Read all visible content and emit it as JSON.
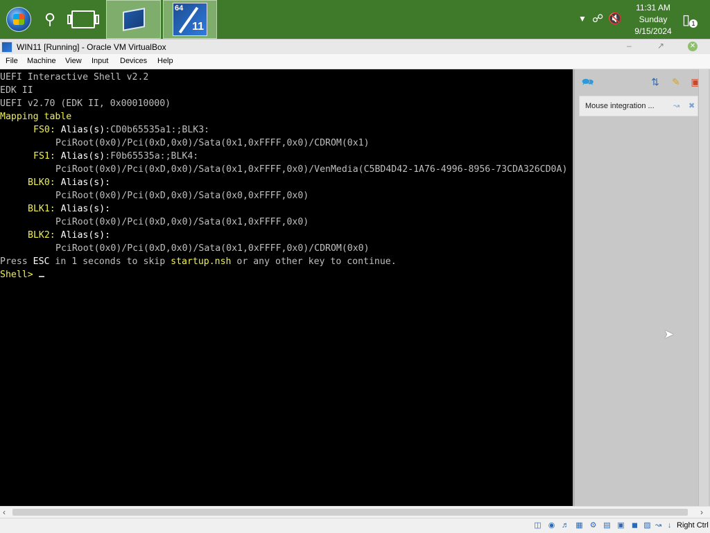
{
  "taskbar": {
    "icons": [
      "windows-start-orb",
      "search-icon",
      "task-view-icon",
      "virtualbox-app-icon",
      "windows-11-vm-icon"
    ],
    "vm_badge_bits": "64",
    "vm_badge_version": "11",
    "tray": {
      "time": "11:31 AM",
      "day": "Sunday",
      "date": "9/15/2024",
      "notification_count": "1"
    }
  },
  "window": {
    "title": "WIN11 [Running] - Oracle VM VirtualBox"
  },
  "menu": {
    "items": [
      "File",
      "Machine",
      "View",
      "Input",
      "Devices",
      "Help"
    ]
  },
  "console": {
    "lines": [
      "UEFI Interactive Shell v2.2",
      "EDK II",
      "UEFI v2.70 (EDK II, 0x00010000)",
      "Mapping table",
      "FS0:",
      "Alias(s)",
      ":CD0b65535a1:;BLK3:",
      "PciRoot(0x0)/Pci(0xD,0x0)/Sata(0x1,0xFFFF,0x0)/CDROM(0x1)",
      "FS1:",
      "Alias(s)",
      ":F0b65535a:;BLK4:",
      "PciRoot(0x0)/Pci(0xD,0x0)/Sata(0x1,0xFFFF,0x0)/VenMedia(C5BD4D42-1A76-4996-8956-73CDA326CD0A)",
      "BLK0:",
      "Alias(s):",
      "PciRoot(0x0)/Pci(0xD,0x0)/Sata(0x0,0xFFFF,0x0)",
      "BLK1:",
      "Alias(s):",
      "PciRoot(0x0)/Pci(0xD,0x0)/Sata(0x1,0xFFFF,0x0)",
      "BLK2:",
      "Alias(s):",
      "PciRoot(0x0)/Pci(0xD,0x0)/Sata(0x1,0xFFFF,0x0)/CDROM(0x0)",
      "Press ",
      "ESC",
      " in 1 seconds to skip ",
      "startup.nsh",
      " or any other key to continue.",
      "Shell>"
    ]
  },
  "side_panel": {
    "mouse_integration_label": "Mouse integration ..."
  },
  "statusbar": {
    "host_key": "Right Ctrl"
  },
  "colors": {
    "taskbar": "#3f7a2a",
    "console_text": "#bfbfbf",
    "console_highlight": "#f2f24a"
  }
}
